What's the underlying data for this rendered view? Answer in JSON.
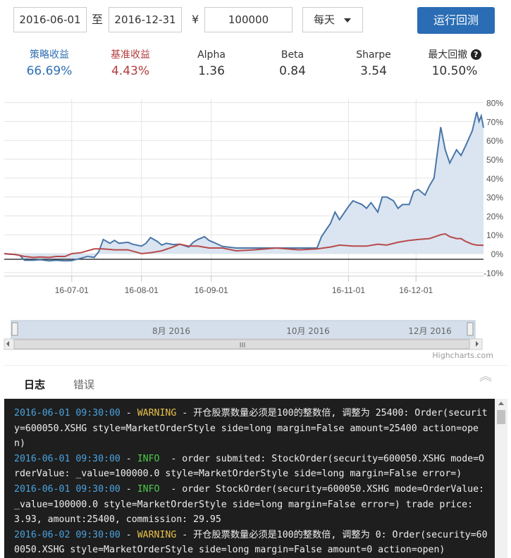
{
  "toolbar": {
    "start_date": "2016-06-01",
    "to_label": "至",
    "end_date": "2016-12-31",
    "currency": "¥",
    "capital": "100000",
    "frequency": "每天",
    "run_label": "运行回测"
  },
  "stats": [
    {
      "label": "策略收益",
      "value": "66.69%",
      "color": "#2f6fb3"
    },
    {
      "label": "基准收益",
      "value": "4.43%",
      "color": "#b43c3c"
    },
    {
      "label": "Alpha",
      "value": "1.36",
      "color": "#333333"
    },
    {
      "label": "Beta",
      "value": "0.84",
      "color": "#333333"
    },
    {
      "label": "Sharpe",
      "value": "3.54",
      "color": "#333333"
    },
    {
      "label": "最大回撤",
      "value": "10.50%",
      "color": "#333333"
    }
  ],
  "chart_data": {
    "type": "area",
    "x_start": "2016-06-01",
    "x_end": "2016-12-31",
    "yticks": [
      "80%",
      "70%",
      "60%",
      "50%",
      "40%",
      "30%",
      "20%",
      "10%",
      "0%",
      "-10%"
    ],
    "ylim": [
      -10,
      80
    ],
    "xticks": [
      "16-07-01",
      "16-08-01",
      "16-09-01",
      "16-11-01",
      "16-12-01"
    ],
    "navigator_labels": [
      "8月 2016",
      "10月 2016",
      "12月 2016"
    ],
    "credit": "Highcharts.com",
    "colors": {
      "strategy": "#4a76a8",
      "benchmark": "#b84a4a",
      "fill": "#d6e2ef"
    },
    "series": [
      {
        "values": [
          [
            "2016-06-01",
            0
          ],
          [
            "2016-06-03",
            -0.3
          ],
          [
            "2016-06-06",
            -0.5
          ],
          [
            "2016-06-08",
            -1
          ],
          [
            "2016-06-10",
            -3.5
          ],
          [
            "2016-06-14",
            -3.5
          ],
          [
            "2016-06-17",
            -3.2
          ],
          [
            "2016-06-21",
            -3.8
          ],
          [
            "2016-06-24",
            -3.5
          ],
          [
            "2016-06-28",
            -3.8
          ],
          [
            "2016-07-01",
            -3.7
          ],
          [
            "2016-07-05",
            -2.5
          ],
          [
            "2016-07-08",
            -1.5
          ],
          [
            "2016-07-11",
            -2
          ],
          [
            "2016-07-13",
            1
          ],
          [
            "2016-07-15",
            7.5
          ],
          [
            "2016-07-18",
            5.5
          ],
          [
            "2016-07-20",
            7
          ],
          [
            "2016-07-22",
            5.5
          ],
          [
            "2016-07-26",
            6
          ],
          [
            "2016-07-28",
            5
          ],
          [
            "2016-08-01",
            4
          ],
          [
            "2016-08-03",
            5.5
          ],
          [
            "2016-08-05",
            8.5
          ],
          [
            "2016-08-08",
            6.5
          ],
          [
            "2016-08-10",
            4.5
          ],
          [
            "2016-08-12",
            5.5
          ],
          [
            "2016-08-15",
            4.8
          ],
          [
            "2016-08-18",
            5
          ],
          [
            "2016-08-22",
            3.5
          ],
          [
            "2016-08-24",
            6
          ],
          [
            "2016-08-26",
            7.5
          ],
          [
            "2016-08-29",
            9
          ],
          [
            "2016-08-31",
            7
          ],
          [
            "2016-09-02",
            6
          ],
          [
            "2016-09-06",
            3.8
          ],
          [
            "2016-09-12",
            3
          ],
          [
            "2016-09-20",
            3
          ],
          [
            "2016-09-30",
            3
          ],
          [
            "2016-10-10",
            3
          ],
          [
            "2016-10-18",
            3
          ],
          [
            "2016-10-20",
            9
          ],
          [
            "2016-10-24",
            16
          ],
          [
            "2016-10-26",
            22
          ],
          [
            "2016-10-28",
            18
          ],
          [
            "2016-11-01",
            25
          ],
          [
            "2016-11-03",
            28
          ],
          [
            "2016-11-07",
            26
          ],
          [
            "2016-11-09",
            24
          ],
          [
            "2016-11-11",
            27
          ],
          [
            "2016-11-14",
            22
          ],
          [
            "2016-11-16",
            30
          ],
          [
            "2016-11-18",
            30
          ],
          [
            "2016-11-21",
            28
          ],
          [
            "2016-11-23",
            24
          ],
          [
            "2016-11-25",
            26
          ],
          [
            "2016-11-28",
            26
          ],
          [
            "2016-11-30",
            33
          ],
          [
            "2016-12-02",
            34
          ],
          [
            "2016-12-05",
            31
          ],
          [
            "2016-12-07",
            36
          ],
          [
            "2016-12-09",
            40
          ],
          [
            "2016-12-12",
            67
          ],
          [
            "2016-12-14",
            55
          ],
          [
            "2016-12-16",
            48
          ],
          [
            "2016-12-19",
            55
          ],
          [
            "2016-12-21",
            52
          ],
          [
            "2016-12-23",
            57
          ],
          [
            "2016-12-26",
            65
          ],
          [
            "2016-12-28",
            75
          ],
          [
            "2016-12-29",
            70
          ],
          [
            "2016-12-30",
            73
          ],
          [
            "2016-12-31",
            66.69
          ]
        ]
      },
      {
        "values": [
          [
            "2016-06-01",
            0
          ],
          [
            "2016-06-06",
            -0.5
          ],
          [
            "2016-06-10",
            -1.5
          ],
          [
            "2016-06-14",
            -2
          ],
          [
            "2016-06-17",
            -1.8
          ],
          [
            "2016-06-21",
            -2
          ],
          [
            "2016-06-24",
            -1.5
          ],
          [
            "2016-06-28",
            -1.5
          ],
          [
            "2016-07-01",
            0
          ],
          [
            "2016-07-05",
            0.5
          ],
          [
            "2016-07-11",
            2.5
          ],
          [
            "2016-07-15",
            2.5
          ],
          [
            "2016-07-20",
            2
          ],
          [
            "2016-07-26",
            2
          ],
          [
            "2016-08-01",
            0
          ],
          [
            "2016-08-05",
            0.5
          ],
          [
            "2016-08-10",
            1.5
          ],
          [
            "2016-08-15",
            3.5
          ],
          [
            "2016-08-18",
            5
          ],
          [
            "2016-08-22",
            4
          ],
          [
            "2016-08-26",
            4
          ],
          [
            "2016-08-31",
            3
          ],
          [
            "2016-09-06",
            3
          ],
          [
            "2016-09-12",
            1.5
          ],
          [
            "2016-09-20",
            2
          ],
          [
            "2016-09-30",
            3
          ],
          [
            "2016-10-10",
            2
          ],
          [
            "2016-10-18",
            2.5
          ],
          [
            "2016-10-24",
            3.5
          ],
          [
            "2016-10-28",
            4.5
          ],
          [
            "2016-11-03",
            4
          ],
          [
            "2016-11-09",
            4
          ],
          [
            "2016-11-14",
            5
          ],
          [
            "2016-11-18",
            4.5
          ],
          [
            "2016-11-23",
            6
          ],
          [
            "2016-11-28",
            7
          ],
          [
            "2016-12-02",
            7.5
          ],
          [
            "2016-12-07",
            8
          ],
          [
            "2016-12-12",
            10
          ],
          [
            "2016-12-14",
            10.5
          ],
          [
            "2016-12-16",
            9
          ],
          [
            "2016-12-19",
            8
          ],
          [
            "2016-12-21",
            8
          ],
          [
            "2016-12-23",
            6.5
          ],
          [
            "2016-12-26",
            5
          ],
          [
            "2016-12-28",
            4.5
          ],
          [
            "2016-12-31",
            4.43
          ]
        ]
      }
    ]
  },
  "tabs": {
    "log": "日志",
    "error": "错误"
  },
  "log_lines": [
    {
      "ts": "2016-06-01 09:30:00",
      "level": "WARNING",
      "msg": "开仓股票数量必须是100的整数倍, 调整为 25400: Order(security=600050.XSHG style=MarketOrderStyle side=long margin=False amount=25400 action=open)"
    },
    {
      "ts": "2016-06-01 09:30:00",
      "level": "INFO ",
      "msg": "order submited: StockOrder(security=600050.XSHG mode=OrderValue: _value=100000.0 style=MarketOrderStyle side=long margin=False error=)"
    },
    {
      "ts": "2016-06-01 09:30:00",
      "level": "INFO ",
      "msg": "order StockOrder(security=600050.XSHG mode=OrderValue: _value=100000.0 style=MarketOrderStyle side=long margin=False error=) trade price: 3.93, amount:25400, commission: 29.95"
    },
    {
      "ts": "2016-06-02 09:30:00",
      "level": "WARNING",
      "msg": "开仓股票数量必须是100的整数倍, 调整为 0: Order(security=600050.XSHG style=MarketOrderStyle side=long margin=False amount=0 action=open)"
    }
  ]
}
